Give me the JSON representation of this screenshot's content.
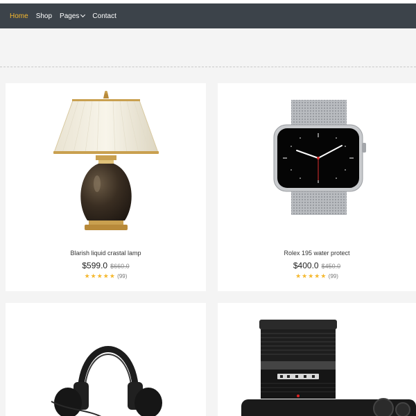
{
  "nav": {
    "items": [
      {
        "label": "Home",
        "active": true
      },
      {
        "label": "Shop",
        "active": false
      },
      {
        "label": "Pages",
        "active": false,
        "dropdown": true
      },
      {
        "label": "Contact",
        "active": false
      }
    ]
  },
  "colors": {
    "nav_bg": "#3c434a",
    "accent": "#f5b82e",
    "page_bg": "#f4f4f4",
    "card_bg": "#ffffff"
  },
  "products": [
    {
      "name": "Blarish liquid crastal lamp",
      "price": "$599.0",
      "old_price": "$660.0",
      "stars": "★★★★★",
      "reviews": "(99)",
      "rating": 5,
      "icon": "table-lamp"
    },
    {
      "name": "Rolex 195 water protect",
      "price": "$400.0",
      "old_price": "$450.0",
      "stars": "★★★★★",
      "reviews": "(99)",
      "rating": 5,
      "icon": "smartwatch"
    },
    {
      "icon": "headphones"
    },
    {
      "icon": "camera"
    }
  ]
}
